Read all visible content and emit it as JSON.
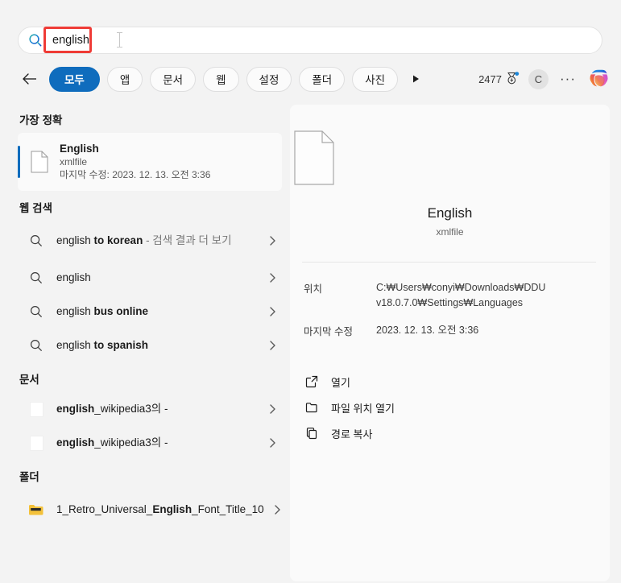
{
  "search": {
    "query": "english",
    "icon": "search-icon"
  },
  "filters": {
    "back_icon": "back-arrow-icon",
    "more_icon": "more-filters-arrow-icon",
    "items": [
      {
        "label": "모두",
        "active": true
      },
      {
        "label": "앱",
        "active": false
      },
      {
        "label": "문서",
        "active": false
      },
      {
        "label": "웹",
        "active": false
      },
      {
        "label": "설정",
        "active": false
      },
      {
        "label": "폴더",
        "active": false
      },
      {
        "label": "사진",
        "active": false
      }
    ]
  },
  "topright": {
    "rewards_count": "2477",
    "rewards_icon": "rewards-medal-icon",
    "avatar_initial": "C",
    "overflow_label": "···",
    "copilot_icon": "copilot-icon"
  },
  "sections": {
    "best_match_title": "가장 정확",
    "web_search_title": "웹 검색",
    "documents_title": "문서",
    "folders_title": "폴더"
  },
  "best_match": {
    "name": "English",
    "type": "xmlfile",
    "modified": "마지막 수정: 2023. 12. 13. 오전 3:36"
  },
  "web_results": [
    {
      "prefix": "english ",
      "bold": "to korean",
      "suffix": " - 검색 결과 더 보기"
    },
    {
      "prefix": "english",
      "bold": "",
      "suffix": ""
    },
    {
      "prefix": "english ",
      "bold": "bus online",
      "suffix": ""
    },
    {
      "prefix": "english ",
      "bold": "to spanish",
      "suffix": ""
    }
  ],
  "documents": [
    {
      "bold": "english",
      "rest": "_wikipedia3의 -"
    },
    {
      "bold": "english",
      "rest": "_wikipedia3의 -"
    }
  ],
  "folders": [
    {
      "prefix": "1_Retro_Universal_",
      "bold": "English",
      "suffix": "_Font_Title_10"
    }
  ],
  "preview": {
    "title": "English",
    "subtitle": "xmlfile",
    "meta": [
      {
        "key": "위치",
        "value": "C:₩Users₩conyi₩Downloads₩DDU v18.0.7.0₩Settings₩Languages"
      },
      {
        "key": "마지막 수정",
        "value": "2023. 12. 13. 오전 3:36"
      }
    ],
    "actions": [
      {
        "label": "열기",
        "icon": "open-external-icon"
      },
      {
        "label": "파일 위치 열기",
        "icon": "folder-open-icon"
      },
      {
        "label": "경로 복사",
        "icon": "copy-icon"
      }
    ]
  },
  "annotation": {
    "type": "red-highlight-box",
    "color": "#ef3b36"
  },
  "colors": {
    "accent": "#0f6cbd",
    "background": "#f3f3f3",
    "panel": "#fafafa"
  }
}
